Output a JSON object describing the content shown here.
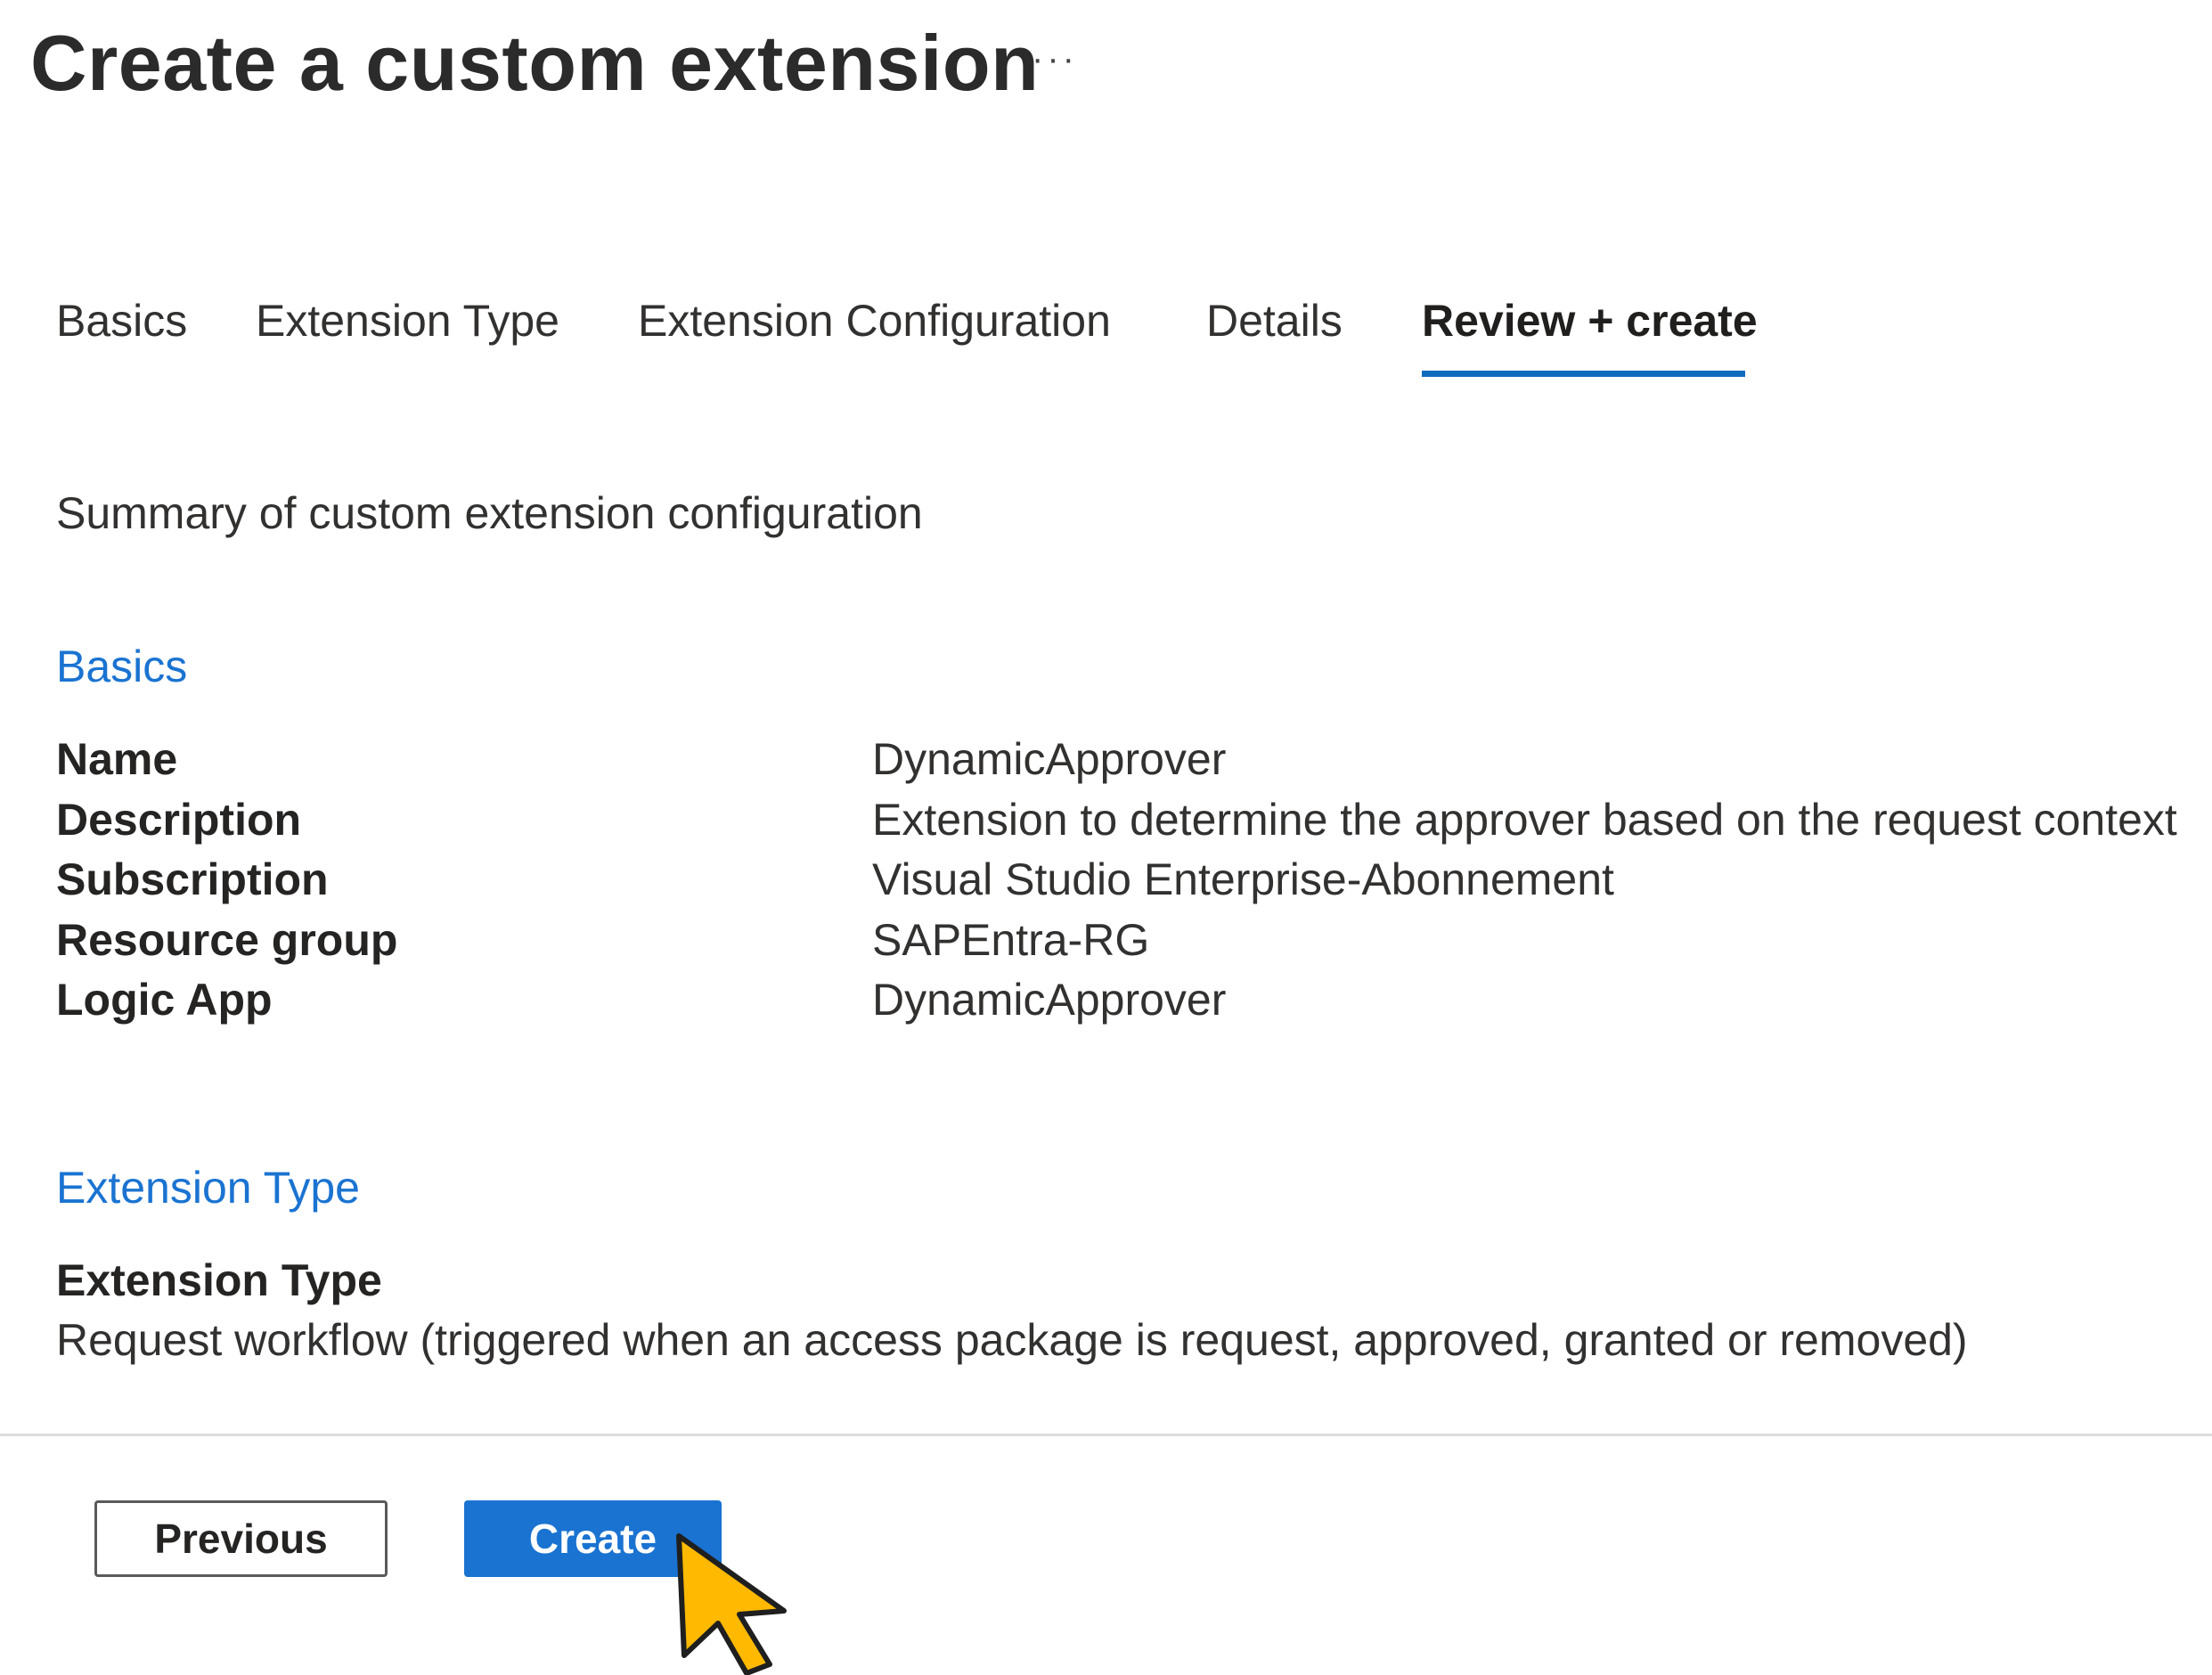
{
  "page": {
    "title": "Create a custom extension",
    "more_icon": "ellipsis-icon",
    "more_label": "···"
  },
  "tabs": [
    {
      "label": "Basics",
      "active": false
    },
    {
      "label": "Extension Type",
      "active": false
    },
    {
      "label": "Extension Configuration",
      "active": false
    },
    {
      "label": "Details",
      "active": false
    },
    {
      "label": "Review + create",
      "active": true
    }
  ],
  "summary": {
    "intro": "Summary of custom extension configuration"
  },
  "basics": {
    "heading": "Basics",
    "rows": [
      {
        "label": "Name",
        "value": "DynamicApprover"
      },
      {
        "label": "Description",
        "value": "Extension to determine the approver based on the request context"
      },
      {
        "label": "Subscription",
        "value": "Visual Studio Enterprise-Abonnement"
      },
      {
        "label": "Resource group",
        "value": "SAPEntra-RG"
      },
      {
        "label": "Logic App",
        "value": "DynamicApprover"
      }
    ]
  },
  "extension_type": {
    "heading": "Extension Type",
    "label": "Extension Type",
    "value": "Request workflow (triggered when an access package is request, approved, granted or removed)"
  },
  "footer": {
    "previous_label": "Previous",
    "create_label": "Create"
  },
  "colors": {
    "accent": "#0f6cbd",
    "link_blue": "#1a73d1",
    "primary_button": "#1a73d1",
    "cursor_fill": "#ffb900"
  },
  "cursor": {
    "icon": "pointer-cursor-icon"
  }
}
